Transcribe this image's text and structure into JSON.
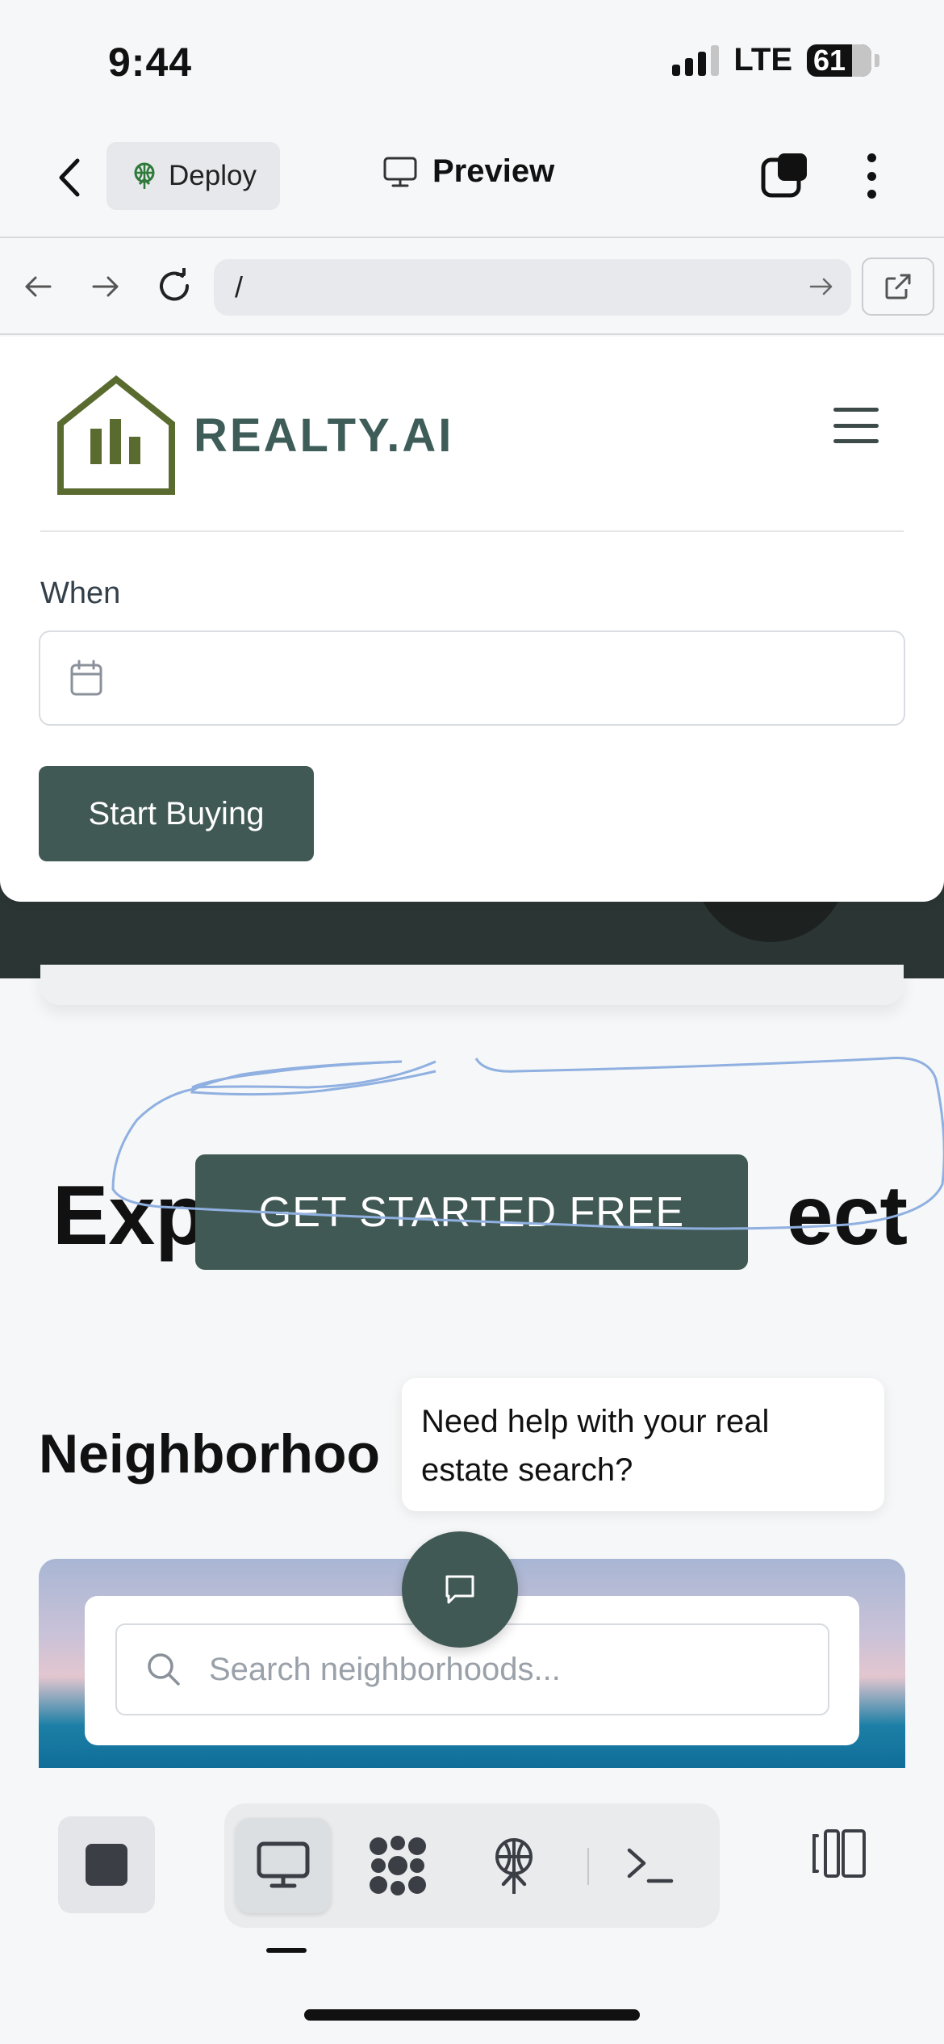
{
  "status_bar": {
    "time": "9:44",
    "network": "LTE",
    "battery": "61"
  },
  "app_bar": {
    "deploy_label": "Deploy",
    "title": "Preview"
  },
  "browser": {
    "url": "/"
  },
  "site": {
    "brand": "REALTY.AI",
    "form": {
      "when_label": "When",
      "date_value": "",
      "submit_label": "Start Buying"
    },
    "hero": {
      "heading_left": "Exp",
      "heading_right": "ect",
      "cta_label": "GET STARTED FREE"
    },
    "neighborhoods": {
      "heading": "Neighborhoo",
      "search_placeholder": "Search neighborhoods..."
    },
    "chat": {
      "bubble_text": "Need help with your real estate search?"
    }
  },
  "colors": {
    "brand_dark": "#415955",
    "logo_green": "#5a6b2f",
    "brand_text": "#3e5c58",
    "sketch_blue": "#8fb0e0"
  },
  "toolbar": {
    "items": [
      "stop",
      "preview",
      "agents",
      "deploy",
      "console",
      "panels"
    ],
    "active": "preview"
  }
}
